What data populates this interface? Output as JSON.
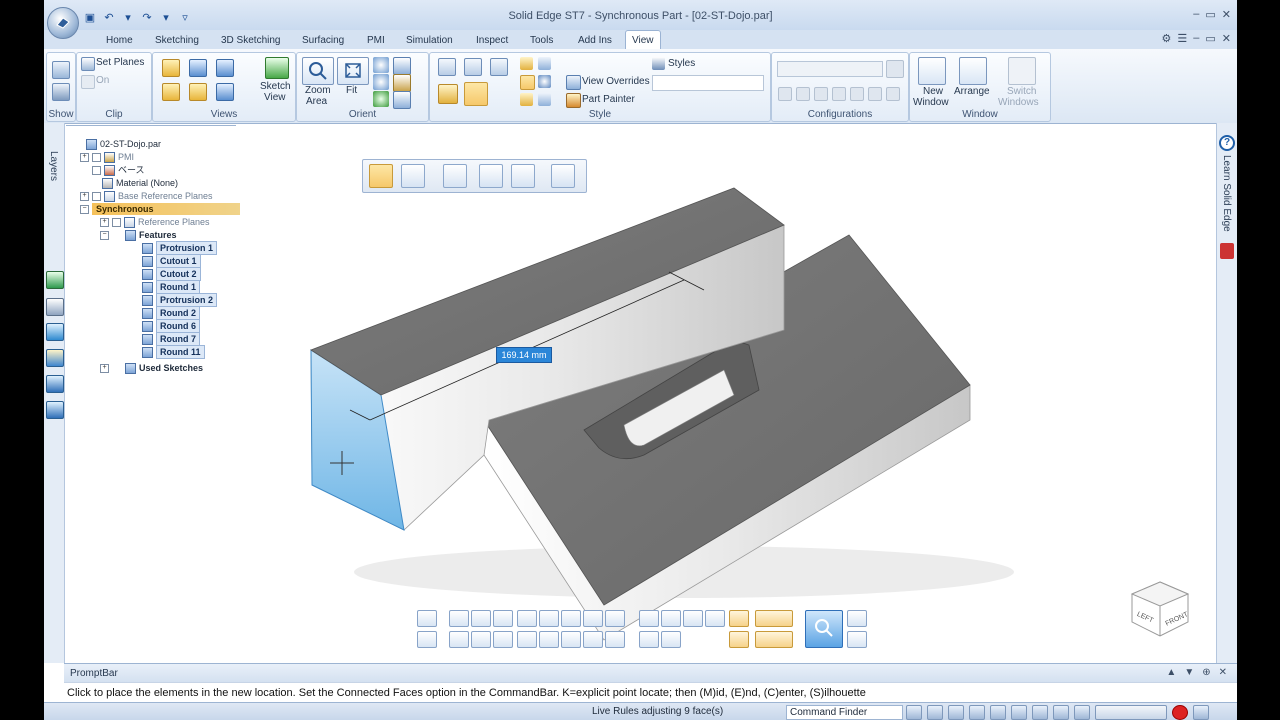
{
  "window": {
    "title": "Solid Edge ST7 - Synchronous Part - [02-ST-Dojo.par]"
  },
  "tabs": [
    "Home",
    "Sketching",
    "3D Sketching",
    "Surfacing",
    "PMI",
    "Simulation",
    "Inspect",
    "Tools",
    "Add Ins",
    "View"
  ],
  "active_tab": "View",
  "ribbon": {
    "show": {
      "label": "Show"
    },
    "clip": {
      "label": "Clip",
      "set_planes": "Set Planes",
      "on": "On"
    },
    "views": {
      "label": "Views",
      "sketch_view_line1": "Sketch",
      "sketch_view_line2": "View"
    },
    "orient": {
      "label": "Orient",
      "zoom_area_line1": "Zoom",
      "zoom_area_line2": "Area",
      "fit": "Fit"
    },
    "style": {
      "label": "Style",
      "styles": "Styles",
      "view_overrides": "View Overrides",
      "part_painter": "Part Painter"
    },
    "configurations": {
      "label": "Configurations"
    },
    "window": {
      "label": "Window",
      "new_window_line1": "New",
      "new_window_line2": "Window",
      "arrange": "Arrange",
      "switch_windows_line1": "Switch",
      "switch_windows_line2": "Windows"
    }
  },
  "side_panels": {
    "layers": "Layers",
    "learn": "Learn Solid Edge"
  },
  "tree": {
    "root": "02-ST-Dojo.par",
    "pmi": "PMI",
    "base": "ベース",
    "material": "Material (None)",
    "base_ref_planes": "Base Reference Planes",
    "synchronous": "Synchronous",
    "ref_planes": "Reference Planes",
    "features": "Features",
    "feature_items": [
      "Protrusion 1",
      "Cutout 1",
      "Cutout 2",
      "Round 1",
      "Protrusion 2",
      "Round 2",
      "Round 6",
      "Round 7",
      "Round 11"
    ],
    "used_sketches": "Used Sketches"
  },
  "dimension": "169.14 mm",
  "viewcube": {
    "front": "FRONT",
    "left": "LEFT"
  },
  "promptbar": {
    "title": "PromptBar",
    "message": "Click to place the elements in the new location.  Set the Connected Faces option in the CommandBar.  K=explicit point locate; then (M)id, (E)nd, (C)enter, (S)ilhouette"
  },
  "status": {
    "text": "Live Rules adjusting 9 face(s)",
    "command_finder": "Command Finder"
  }
}
